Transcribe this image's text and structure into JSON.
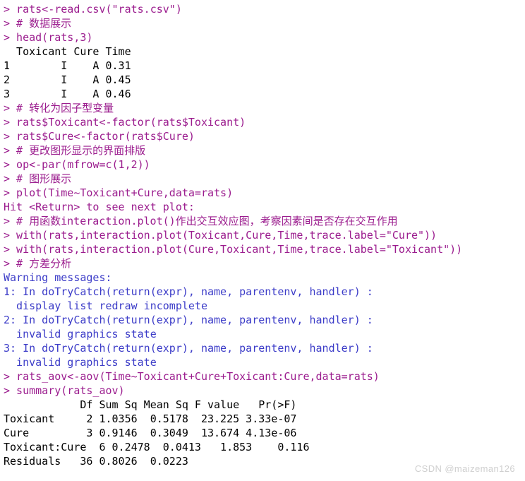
{
  "console": {
    "background": "#ffffff",
    "command_color": "#9B1C8E",
    "output_color": "#000000",
    "warning_color": "#3C3CC8",
    "lines": [
      {
        "text": "> rats<-read.csv(\"rats.csv\")",
        "kind": "cmd"
      },
      {
        "text": "> # 数据展示",
        "kind": "cmd"
      },
      {
        "text": "> head(rats,3)",
        "kind": "cmd"
      },
      {
        "text": "  Toxicant Cure Time",
        "kind": "out"
      },
      {
        "text": "1        I    A 0.31",
        "kind": "out"
      },
      {
        "text": "2        I    A 0.45",
        "kind": "out"
      },
      {
        "text": "3        I    A 0.46",
        "kind": "out"
      },
      {
        "text": "> # 转化为因子型变量",
        "kind": "cmd"
      },
      {
        "text": "> rats$Toxicant<-factor(rats$Toxicant)",
        "kind": "cmd"
      },
      {
        "text": "> rats$Cure<-factor(rats$Cure)",
        "kind": "cmd"
      },
      {
        "text": "> # 更改图形显示的界面排版",
        "kind": "cmd"
      },
      {
        "text": "> op<-par(mfrow=c(1,2))",
        "kind": "cmd"
      },
      {
        "text": "> # 图形展示",
        "kind": "cmd"
      },
      {
        "text": "> plot(Time~Toxicant+Cure,data=rats)",
        "kind": "cmd"
      },
      {
        "text": "Hit <Return> to see next plot:",
        "kind": "cmd"
      },
      {
        "text": "> # 用函数interaction.plot()作出交互效应图，考察因素间是否存在交互作用",
        "kind": "cmd"
      },
      {
        "text": "> with(rats,interaction.plot(Toxicant,Cure,Time,trace.label=\"Cure\"))",
        "kind": "cmd"
      },
      {
        "text": "> with(rats,interaction.plot(Cure,Toxicant,Time,trace.label=\"Toxicant\"))",
        "kind": "cmd"
      },
      {
        "text": "> # 方差分析",
        "kind": "cmd"
      },
      {
        "text": "Warning messages:",
        "kind": "warn"
      },
      {
        "text": "1: In doTryCatch(return(expr), name, parentenv, handler) :",
        "kind": "warn"
      },
      {
        "text": "  display list redraw incomplete",
        "kind": "warn"
      },
      {
        "text": "2: In doTryCatch(return(expr), name, parentenv, handler) :",
        "kind": "warn"
      },
      {
        "text": "  invalid graphics state",
        "kind": "warn"
      },
      {
        "text": "3: In doTryCatch(return(expr), name, parentenv, handler) :",
        "kind": "warn"
      },
      {
        "text": "  invalid graphics state",
        "kind": "warn"
      },
      {
        "text": "> rats_aov<-aov(Time~Toxicant+Cure+Toxicant:Cure,data=rats)",
        "kind": "cmd"
      },
      {
        "text": "> summary(rats_aov)",
        "kind": "cmd"
      },
      {
        "text": "            Df Sum Sq Mean Sq F value   Pr(>F)",
        "kind": "out"
      },
      {
        "text": "Toxicant     2 1.0356  0.5178  23.225 3.33e-07",
        "kind": "out"
      },
      {
        "text": "Cure         3 0.9146  0.3049  13.674 4.13e-06",
        "kind": "out"
      },
      {
        "text": "Toxicant:Cure  6 0.2478  0.0413   1.853    0.116",
        "kind": "out"
      },
      {
        "text": "Residuals   36 0.8026  0.0223",
        "kind": "out"
      }
    ],
    "anova_table": {
      "headers": [
        "",
        "Df",
        "Sum Sq",
        "Mean Sq",
        "F value",
        "Pr(>F)"
      ],
      "rows": [
        {
          "term": "Toxicant",
          "df": "2",
          "sum_sq": "1.0356",
          "mean_sq": "0.5178",
          "f_value": "23.225",
          "pr_f": "3.33e-07"
        },
        {
          "term": "Cure",
          "df": "3",
          "sum_sq": "0.9146",
          "mean_sq": "0.3049",
          "f_value": "13.674",
          "pr_f": "4.13e-06"
        },
        {
          "term": "Toxicant:Cure",
          "df": "6",
          "sum_sq": "0.2478",
          "mean_sq": "0.0413",
          "f_value": "1.853",
          "pr_f": "0.116"
        },
        {
          "term": "Residuals",
          "df": "36",
          "sum_sq": "0.8026",
          "mean_sq": "0.0223",
          "f_value": "",
          "pr_f": ""
        }
      ]
    },
    "head_table": {
      "headers": [
        "Toxicant",
        "Cure",
        "Time"
      ],
      "rows": [
        {
          "index": "1",
          "toxicant": "I",
          "cure": "A",
          "time": "0.31"
        },
        {
          "index": "2",
          "toxicant": "I",
          "cure": "A",
          "time": "0.45"
        },
        {
          "index": "3",
          "toxicant": "I",
          "cure": "A",
          "time": "0.46"
        }
      ]
    }
  },
  "watermark": {
    "text": "CSDN @maizeman126",
    "color": "#cfcfcf"
  }
}
